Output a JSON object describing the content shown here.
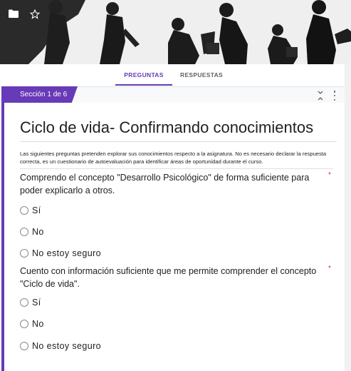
{
  "tabs": {
    "questions": "PREGUNTAS",
    "responses": "RESPUESTAS"
  },
  "section": {
    "label": "Sección 1 de 6"
  },
  "form": {
    "title": "Ciclo de vida- Confirmando conocimientos",
    "description": "Las siguientes preguntas pretenden explorar sus conocimientos respecto a la asignatura. No es necesario declarar la respuesta correcta, es un cuestionario de autoevaluación para identificar áreas de oportunidad durante el curso."
  },
  "questions": [
    {
      "text": "Comprendo el concepto \"Desarrollo Psicológico\" de forma suficiente para poder explicarlo a otros.",
      "required_mark": "*",
      "options": [
        "Sí",
        "No",
        "No estoy seguro"
      ]
    },
    {
      "text": "Cuento con información suficiente que me permite comprender el concepto \"Ciclo de vida\".",
      "required_mark": "*",
      "options": [
        "Sí",
        "No",
        "No estoy seguro"
      ]
    }
  ],
  "icons": {
    "header_left": "folder-icon",
    "header_right": "star-icon",
    "collapse": "collapse-section-icon",
    "more": "more-vert-icon"
  },
  "colors": {
    "accent": "#673ab7",
    "required": "#d93025"
  }
}
